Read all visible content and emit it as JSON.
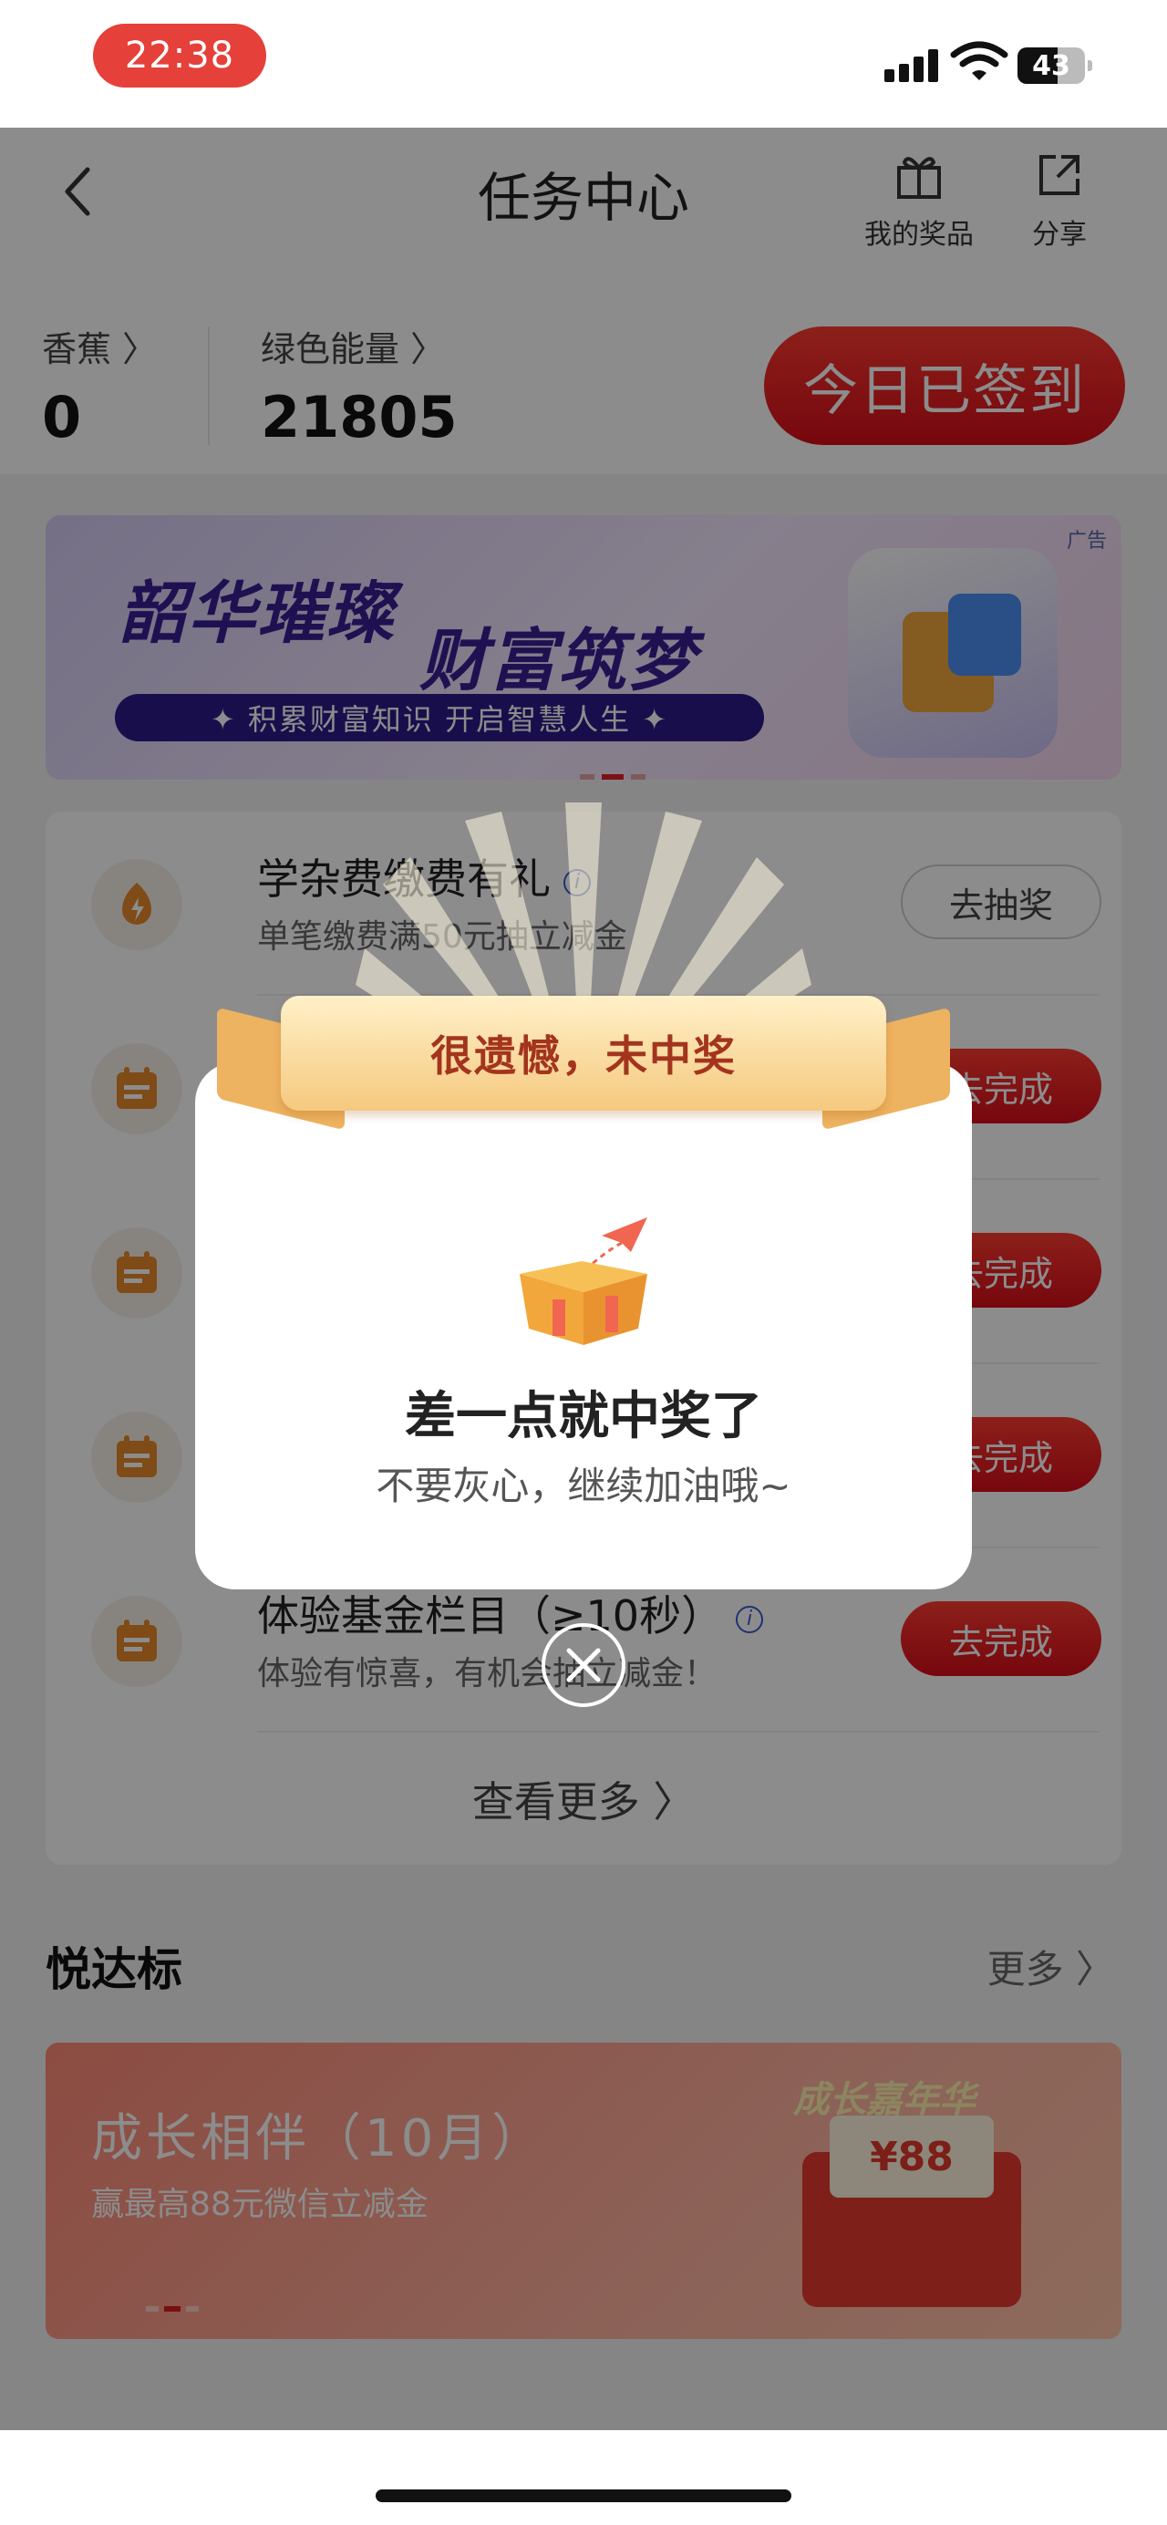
{
  "status": {
    "time": "22:38",
    "battery": "43"
  },
  "header": {
    "title": "任务中心",
    "prizes_label": "我的奖品",
    "share_label": "分享"
  },
  "points": {
    "banana_label": "香蕉 〉",
    "banana_value": "0",
    "energy_label": "绿色能量 〉",
    "energy_value": "21805",
    "signed_label": "今日已签到"
  },
  "banner": {
    "ad_tag": "广告",
    "headline_1": "韶华璀璨",
    "headline_2": "财富筑梦",
    "strip": "✦ 积累财富知识  开启智慧人生 ✦"
  },
  "tasks": [
    {
      "name": "学杂费缴费有礼",
      "desc": "单笔缴费满50元抽立减金",
      "button": "去抽奖",
      "style": "outline",
      "icon": "bolt-icon",
      "info": true
    },
    {
      "name": "",
      "desc": "",
      "button": "去完成",
      "style": "red",
      "icon": "calendar-icon",
      "info": false
    },
    {
      "name": "",
      "desc": "",
      "button": "去完成",
      "style": "red",
      "icon": "calendar-icon",
      "info": false
    },
    {
      "name": "",
      "desc": "",
      "button": "去完成",
      "style": "red",
      "icon": "calendar-icon",
      "info": false
    },
    {
      "name": "体验基金栏目（≥10秒）",
      "desc": "体验有惊喜，有机会抽立减金！",
      "button": "去完成",
      "style": "red",
      "icon": "calendar-icon",
      "info": true
    }
  ],
  "tasks_more": "查看更多 〉",
  "section": {
    "title": "悦达标",
    "more": "更多 〉"
  },
  "growth": {
    "title": "成长相伴（10月）",
    "subtitle": "赢最高88元微信立减金",
    "badge": "成长嘉年华",
    "box_text": "¥88"
  },
  "dialog": {
    "ribbon": "很遗憾，未中奖",
    "main": "差一点就中奖了",
    "sub": "不要灰心，继续加油哦~"
  },
  "colors": {
    "accent_red": "#e0202a",
    "ribbon_gold": "#f5c97f",
    "ribbon_text": "#a3341d"
  }
}
